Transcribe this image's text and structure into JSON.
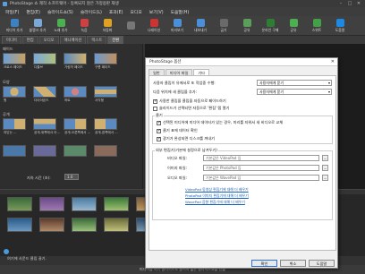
{
  "titlebar": {
    "title": "PhotoStage 쇼 제작 소프트웨어 - 등록되지 않은 가정용판 재생"
  },
  "menus": [
    "파일(F)",
    "편집(E)",
    "슬라이드쇼(S)",
    "슬라이드(L)",
    "효과(E)",
    "오디오",
    "보기(V)",
    "도움말(H)"
  ],
  "toolbar": [
    {
      "label": "미디어 추가",
      "color": "#3b82c4"
    },
    {
      "label": "블랭크 추가",
      "color": "#7aa8d8"
    },
    {
      "label": "노래 추가",
      "color": "#4caf50"
    },
    {
      "label": "녹음",
      "color": "#d04040"
    },
    {
      "label": "자동화",
      "color": "#e0a020"
    },
    {
      "label": "",
      "color": "#777"
    },
    {
      "label": "나레이션",
      "color": "#cc3333"
    },
    {
      "label": "미리보기",
      "color": "#4a90d9"
    },
    {
      "label": "내보내기",
      "color": "#4a90d9"
    },
    {
      "label": "굽기",
      "color": "#6a6a6a"
    },
    {
      "label": "공유",
      "color": "#5a9e5a"
    },
    {
      "label": "온라인 구매",
      "color": "#2e7d32"
    },
    {
      "label": "공유",
      "color": "#4caf50"
    },
    {
      "label": "스위트",
      "color": "#43a047"
    },
    {
      "label": "도움말",
      "color": "#1e88e5"
    }
  ],
  "tabs": [
    "미디어",
    "편집",
    "오디오",
    "애니메이션",
    "텍스트",
    "전환"
  ],
  "effects": {
    "sections": [
      "페이드",
      "모양",
      "공개"
    ],
    "row1": [
      "크로스 페이드",
      "디졸브",
      "가림막 페이드",
      "구름 페이드"
    ],
    "row2": [
      "원",
      "다이아몬드",
      "하트",
      "사각형"
    ],
    "row3": [
      "여닫는 ...",
      "공개-위쪽에서 아...",
      "공개-오른쪽에서 ...",
      "공개-왼쪽에서 ..."
    ],
    "duration_label": "지속 시간 (초):",
    "duration_value": "1.0"
  },
  "dialog": {
    "title": "PhotoStage 옵션",
    "tabs": [
      "일반",
      "미디어 파일",
      "기타"
    ],
    "active_tab": "기타",
    "sort_label": "사용자 클립이 유에서로 또 작업중 수행:",
    "sort_value": "사용자에게 묻기",
    "add_label": "다음 위치에 새 클립을 추가:",
    "add_value": "사용자에게 묻기",
    "checks": [
      {
        "label": "사용한 클립을 클립을 자동으로 페이드하기",
        "on": true
      },
      {
        "label": "슬라이드가 선택되면 자동으로 '편집' 탭 열기",
        "on": false
      }
    ],
    "group1_label": "클기",
    "group1_checks": [
      {
        "label": "선택된 미디어에 미디어 데이터가 있는 경우, 미리를 지워서 새 비디오로 교체",
        "on": true
      },
      {
        "label": "클기 표에 데이터 확인",
        "on": true
      },
      {
        "label": "광기가 완성되면 디스크를 꺼내기",
        "on": true
      }
    ],
    "group2_label": "외부 편집기(기본에 설정으로 남겨두기)",
    "editors": [
      {
        "label": "비디오 파일:",
        "value": "기본값은 VideoPad 임"
      },
      {
        "label": "이미지 파일:",
        "value": "기본값은 PhotoPad 임"
      },
      {
        "label": "오디오 파일:",
        "value": "기본값은 WavePad 임"
      }
    ],
    "links": [
      "VideoPad 동영상 편집기에 대해 더 배우기",
      "PhotoPad 이미지 편집기에 대해 더 배우기",
      "WavePad 음향 편집기에 대해 더 배우기"
    ],
    "buttons": {
      "ok": "확인",
      "cancel": "취소",
      "help": "도움말"
    }
  },
  "timeline_info": "여기에 사운드 클립 끌기.",
  "statusbar": "미디어를 여기 슬라이드로 끌어서 짧은 슬라이드쇼를 만듦",
  "colors": {
    "accent": "#2a6fd6",
    "link": "#1a5fb4"
  }
}
